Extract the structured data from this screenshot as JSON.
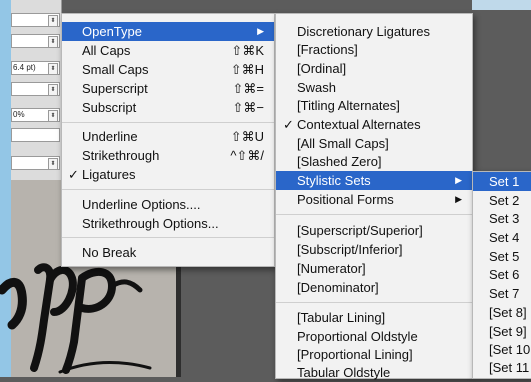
{
  "panel": {
    "fields": [
      "",
      "",
      "6.4 pt)",
      "",
      "0%",
      "",
      ""
    ]
  },
  "main_menu": {
    "items": [
      {
        "label": "OpenType",
        "shortcut": "",
        "submenu": true,
        "highlighted": true
      },
      {
        "label": "All Caps",
        "shortcut": "⇧⌘K"
      },
      {
        "label": "Small Caps",
        "shortcut": "⇧⌘H"
      },
      {
        "label": "Superscript",
        "shortcut": "⇧⌘="
      },
      {
        "label": "Subscript",
        "shortcut": "⇧⌘−"
      },
      {
        "label": "Underline",
        "shortcut": "⇧⌘U"
      },
      {
        "label": "Strikethrough",
        "shortcut": "^⇧⌘/"
      },
      {
        "label": "Ligatures",
        "shortcut": "",
        "checked": true
      },
      {
        "label": "Underline Options....",
        "shortcut": ""
      },
      {
        "label": "Strikethrough Options...",
        "shortcut": ""
      },
      {
        "label": "No Break",
        "shortcut": ""
      }
    ]
  },
  "opentype_menu": {
    "items": [
      {
        "label": "Discretionary Ligatures"
      },
      {
        "label": "[Fractions]"
      },
      {
        "label": "[Ordinal]"
      },
      {
        "label": "Swash"
      },
      {
        "label": "[Titling Alternates]"
      },
      {
        "label": "Contextual Alternates",
        "checked": true
      },
      {
        "label": "[All Small Caps]"
      },
      {
        "label": "[Slashed Zero]"
      },
      {
        "label": "Stylistic Sets",
        "submenu": true,
        "highlighted": true
      },
      {
        "label": "Positional Forms",
        "submenu": true
      },
      {
        "label": "[Superscript/Superior]"
      },
      {
        "label": "[Subscript/Inferior]"
      },
      {
        "label": "[Numerator]"
      },
      {
        "label": "[Denominator]"
      },
      {
        "label": "[Tabular Lining]"
      },
      {
        "label": "Proportional Oldstyle"
      },
      {
        "label": "[Proportional Lining]"
      },
      {
        "label": "Tabular Oldstyle"
      }
    ]
  },
  "stylistic_sets_menu": {
    "items": [
      {
        "label": "Set 1",
        "highlighted": true
      },
      {
        "label": "Set 2"
      },
      {
        "label": "Set 3"
      },
      {
        "label": "Set 4"
      },
      {
        "label": "Set 5"
      },
      {
        "label": "Set 6"
      },
      {
        "label": "Set 7"
      },
      {
        "label": "[Set 8]"
      },
      {
        "label": "[Set 9]"
      },
      {
        "label": "[Set 10"
      },
      {
        "label": "[Set 11"
      }
    ]
  },
  "icons": {
    "check": "✓",
    "submenu_arrow": "▶",
    "stepper": "⬍"
  },
  "colors": {
    "highlight": "#2a66c9",
    "menu_bg": "#f2f2f2"
  }
}
